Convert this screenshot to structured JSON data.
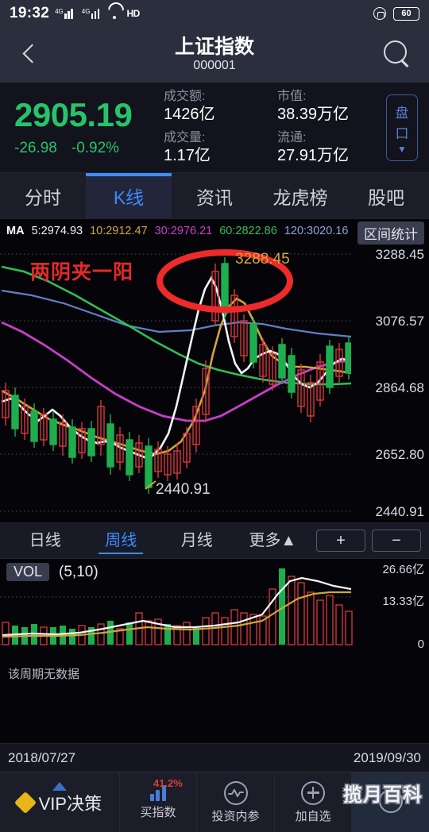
{
  "status_bar": {
    "time": "19:32",
    "network_label": "4G",
    "hd_label": "HD",
    "battery": "60",
    "icons": [
      "signal-icon",
      "signal-icon",
      "wifi-icon",
      "hd-icon",
      "lock-icon",
      "battery-icon"
    ]
  },
  "header": {
    "back_icon": "back-chevron-icon",
    "title": "上证指数",
    "code": "000001",
    "search_icon": "search-icon"
  },
  "quote": {
    "last_price": "2905.19",
    "change": "-26.98",
    "change_pct": "-0.92%",
    "color_down": "#25c46a",
    "stats": [
      {
        "label": "成交额:",
        "value": "1426亿"
      },
      {
        "label": "成交量:",
        "value": "1.17亿"
      },
      {
        "label": "市值:",
        "value": "38.39万亿"
      },
      {
        "label": "流通:",
        "value": "27.91万亿"
      }
    ],
    "pankou_label_1": "盘",
    "pankou_label_2": "口",
    "pankou_icon": "chevron-down-icon"
  },
  "tabs": [
    {
      "label": "分时",
      "active": false
    },
    {
      "label": "K线",
      "active": true
    },
    {
      "label": "资讯",
      "active": false
    },
    {
      "label": "龙虎榜",
      "active": false
    },
    {
      "label": "股吧",
      "active": false
    }
  ],
  "ma_legend": {
    "prefix": "MA",
    "items": [
      {
        "text": "5:2974.93",
        "color": "#f2f3f7"
      },
      {
        "text": "10:2912.47",
        "color": "#d0a63a"
      },
      {
        "text": "30:2976.21",
        "color": "#c93ec9"
      },
      {
        "text": "60:2822.86",
        "color": "#2fbf55"
      },
      {
        "text": "120:3020.16",
        "color": "#8aa5d8"
      }
    ],
    "range_stats_button": "区间统计"
  },
  "chart_annotations": {
    "pattern_text": "两阴夹一阳",
    "pattern_color": "#e02b2b",
    "high_label": "3288.45",
    "low_label": "2440.91",
    "ellipse_color": "#ee2a2a"
  },
  "periods": [
    {
      "label": "日线",
      "active": false
    },
    {
      "label": "周线",
      "active": true
    },
    {
      "label": "月线",
      "active": false
    },
    {
      "label": "更多▲",
      "active": false
    }
  ],
  "zoom_buttons": {
    "plus": "+",
    "minus": "−"
  },
  "volume_panel": {
    "badge": "VOL",
    "params": "(5,10)",
    "no_data_text": "该周期无数据",
    "fullscreen_icon": "expand-arrows-icon"
  },
  "date_range": {
    "start": "2018/07/27",
    "end": "2019/09/30"
  },
  "bottom_nav": [
    {
      "label": "VIP决策",
      "icon": "diamond-icon",
      "badge": "",
      "highlight": false
    },
    {
      "label": "买指数",
      "icon": "bar-chart-icon",
      "badge": "41.2%",
      "highlight": false
    },
    {
      "label": "投资内参",
      "icon": "pulse-circle-icon",
      "badge": "",
      "highlight": false
    },
    {
      "label": "加自选",
      "icon": "plus-circle-icon",
      "badge": "",
      "highlight": false
    },
    {
      "label": "",
      "icon": "more-dots-icon",
      "badge": "",
      "highlight": true
    }
  ],
  "watermark": "揽月百科",
  "chart_data": {
    "type": "line",
    "title": "上证指数 000001 周线",
    "xlabel": "",
    "ylabel": "",
    "grid": true,
    "y_ticks": [
      "3288.45",
      "3076.57",
      "2864.68",
      "2652.80",
      "2440.91"
    ],
    "ylim": [
      2440.91,
      3288.45
    ],
    "x_range": [
      "2018/07/27",
      "2019/09/30"
    ],
    "period": "周线",
    "high": 3288.45,
    "low": 2440.91,
    "last_close": 2905.19,
    "ma_values": {
      "MA5": 2974.93,
      "MA10": 2912.47,
      "MA30": 2976.21,
      "MA60": 2822.86,
      "MA120": 3020.16
    },
    "candles_up_color": "#d8383f",
    "candles_down_color": "#1fae4e",
    "volume": {
      "indicator": "VOL",
      "params": "(5,10)",
      "y_ticks": [
        "26.66亿",
        "13.33亿",
        "0"
      ],
      "ylim": [
        0,
        26.66
      ]
    }
  }
}
